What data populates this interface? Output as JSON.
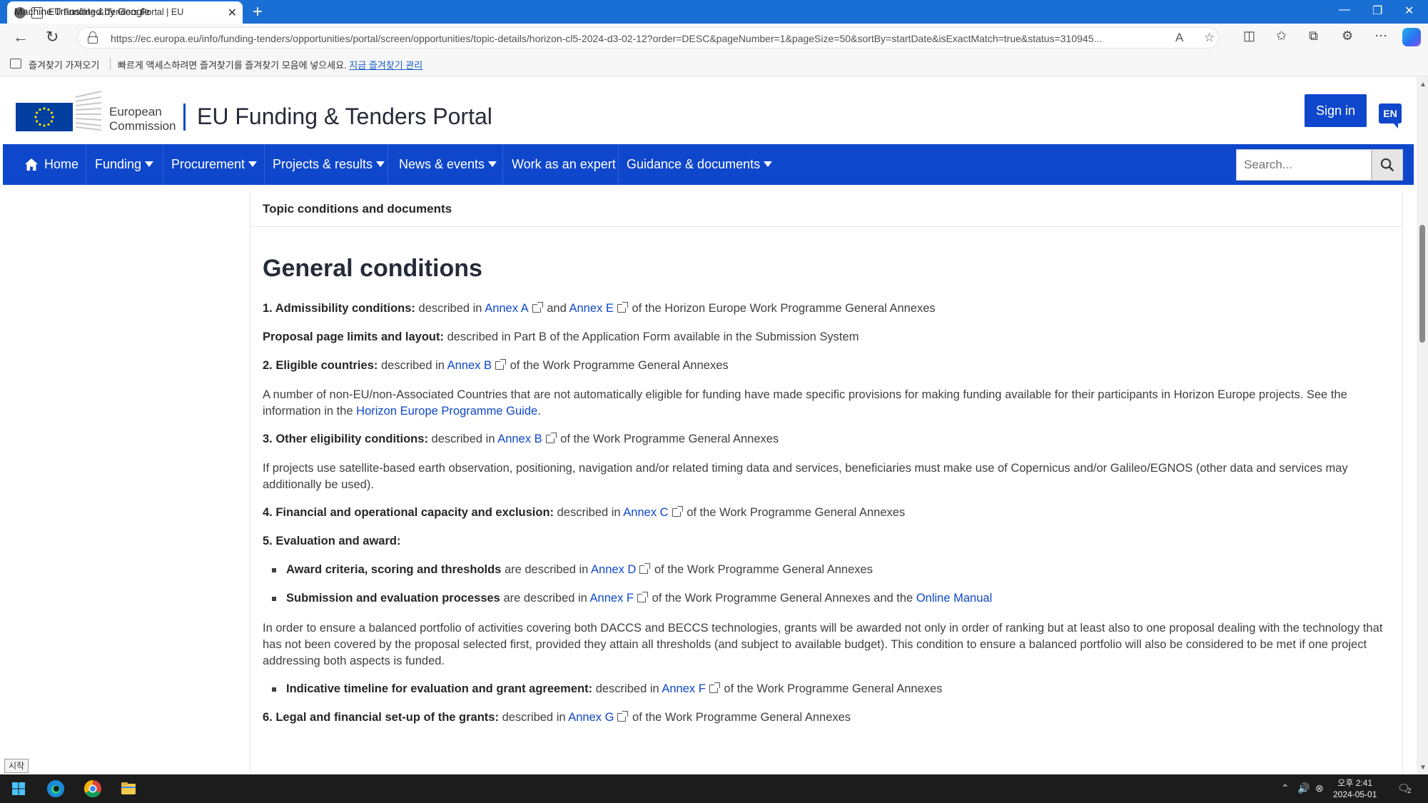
{
  "browser": {
    "tab": {
      "overlay_text": "Machine Translated by Google",
      "title": "EU Funding & Tenders Portal | EU"
    },
    "url": "https://ec.europa.eu/info/funding-tenders/opportunities/portal/screen/opportunities/topic-details/horizon-cl5-2024-d3-02-12?order=DESC&pageNumber=1&pageSize=50&sortBy=startDate&isExactMatch=true&status=310945...",
    "favorites_bar": {
      "import_label": "즐겨찾기 가져오기",
      "hint": "빠르게 액세스하려면 즐겨찾기를 즐겨찾기 모음에 넣으세요.",
      "manage_link": "지금 즐겨찾기 관리"
    }
  },
  "header": {
    "ec_name_line1": "European",
    "ec_name_line2": "Commission",
    "portal_title": "EU Funding & Tenders Portal",
    "sign_in": "Sign in",
    "language": "EN"
  },
  "nav": {
    "items": [
      {
        "label": "Home"
      },
      {
        "label": "Funding"
      },
      {
        "label": "Procurement"
      },
      {
        "label": "Projects & results"
      },
      {
        "label": "News & events"
      },
      {
        "label": "Work as an expert"
      },
      {
        "label": "Guidance & documents"
      }
    ],
    "search_placeholder": "Search..."
  },
  "content": {
    "section_title": "Topic conditions and documents",
    "heading": "General conditions",
    "admissibility": {
      "label": "1. Admissibility conditions:",
      "pre": "described in",
      "link1": "Annex A",
      "mid": "and",
      "link2": "Annex E",
      "post": "of the Horizon Europe Work Programme General Annexes"
    },
    "page_limits": {
      "label": "Proposal page limits and layout:",
      "text": "described in Part B of the Application Form available in the Submission System"
    },
    "eligible_countries": {
      "label": "2. Eligible countries:",
      "pre": "described in",
      "link": "Annex B",
      "post": "of the Work Programme General Annexes"
    },
    "non_eu_para": {
      "text": "A number of non-EU/non-Associated Countries that are not automatically eligible for funding have made specific provisions for making funding available for their participants in Horizon Europe projects. See the information in the",
      "link": "Horizon Europe Programme Guide",
      "end": "."
    },
    "other_eligibility": {
      "label": "3. Other eligibility conditions:",
      "pre": "described in",
      "link": "Annex B",
      "post": "of the Work Programme General Annexes"
    },
    "satellite_para": "If projects use satellite-based earth observation, positioning, navigation and/or related timing data and services, beneficiaries must make use of Copernicus and/or Galileo/EGNOS (other data and services may additionally be used).",
    "financial": {
      "label": "4. Financial and operational capacity and exclusion:",
      "pre": "described in",
      "link": "Annex C",
      "post": "of the Work Programme General Annexes"
    },
    "evaluation_label": "5. Evaluation and award:",
    "award_criteria": {
      "label": "Award criteria, scoring and thresholds",
      "pre": "are described in",
      "link": "Annex D",
      "post": "of the Work Programme General Annexes"
    },
    "submission": {
      "label": "Submission and evaluation processes",
      "pre": "are described in",
      "link": "Annex F",
      "mid": "of the Work Programme General Annexes and the",
      "link2": "Online Manual"
    },
    "balanced_para": "In order to ensure a balanced portfolio of activities covering both DACCS and BECCS technologies, grants will be awarded not only in order of ranking but at least also to one proposal dealing with the technology that has not been covered by the proposal selected first, provided they attain all thresholds (and subject to available budget). This condition to ensure a balanced portfolio will also be considered to be met if one project addressing both aspects is funded.",
    "timeline": {
      "label": "Indicative timeline for evaluation and grant agreement:",
      "pre": "described in",
      "link": "Annex F",
      "post": "of the Work Programme General Annexes"
    },
    "legal": {
      "label": "6. Legal and financial set-up of the grants:",
      "pre": "described in",
      "link": "Annex G",
      "post": "of the Work Programme General Annexes"
    }
  },
  "os": {
    "start_tooltip": "시작",
    "time": "오후 2:41",
    "date": "2024-05-01",
    "notification_count": "2"
  },
  "colors": {
    "brand_blue": "#0e47cb",
    "browser_titlebar": "#1a6fd4"
  }
}
